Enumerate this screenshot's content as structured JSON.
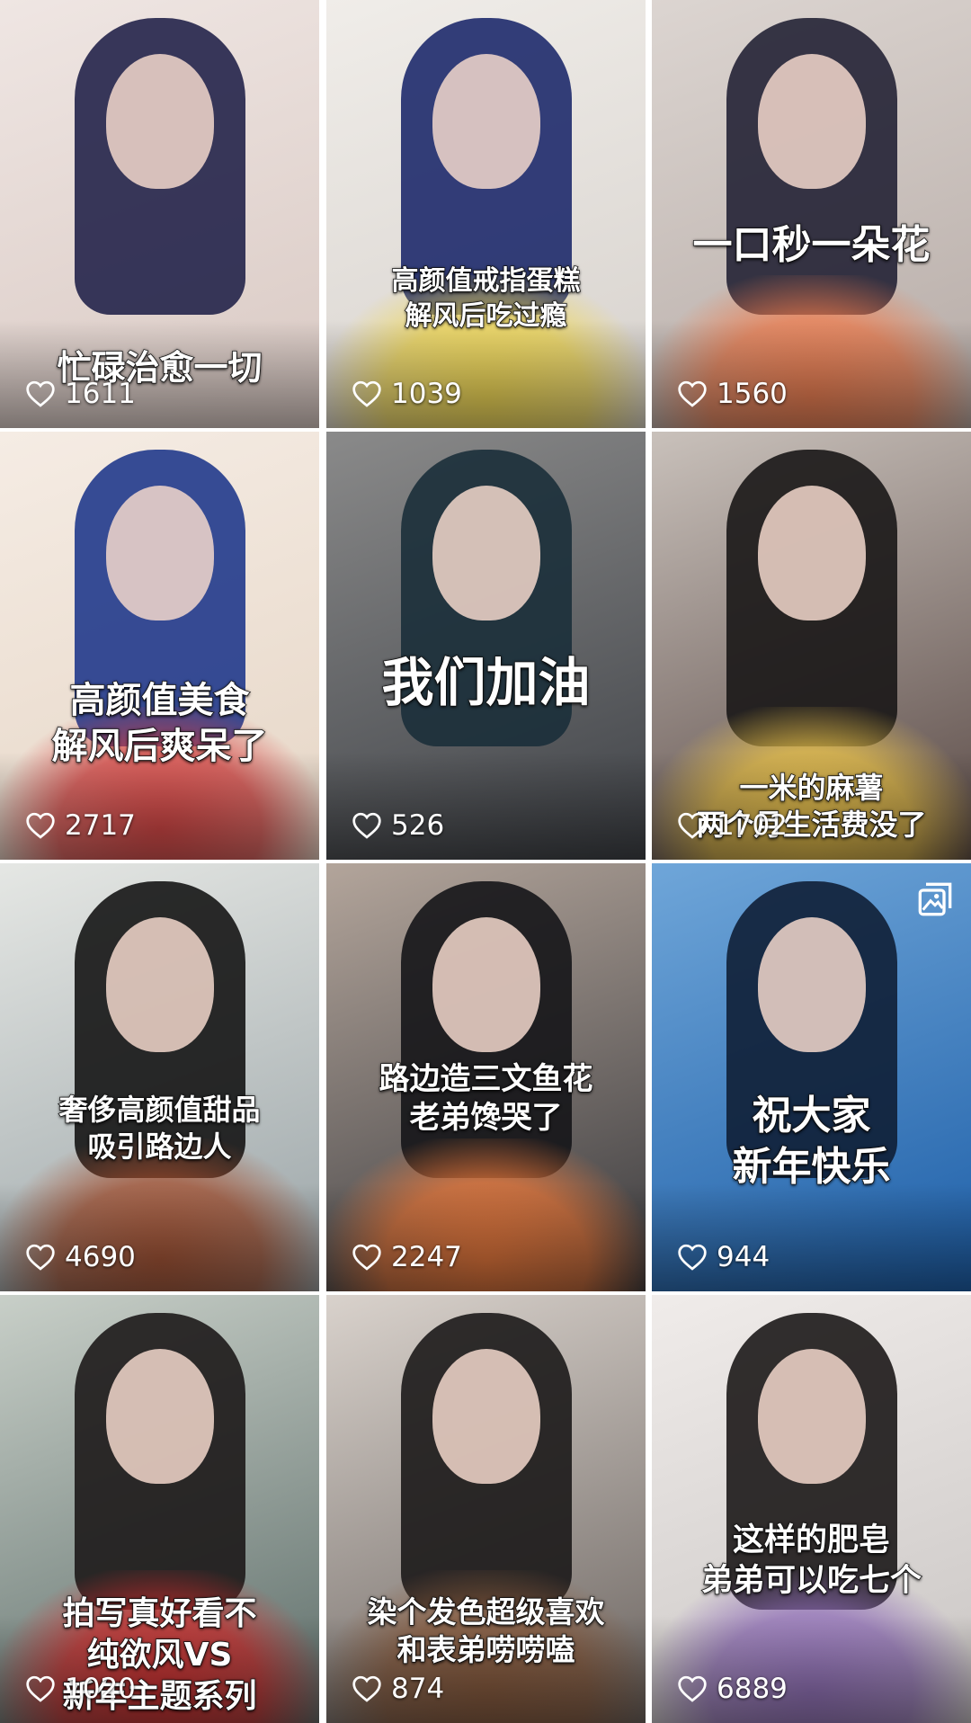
{
  "feed": {
    "items": [
      {
        "caption": [
          "忙碌治愈一切"
        ],
        "likes": "1611",
        "bg": [
          "#d9c9c3",
          "#efe6e3"
        ],
        "hair": "#23244a",
        "food": "",
        "icon": "heart-icon"
      },
      {
        "caption": [
          "高颜值戒指蛋糕",
          "解风后吃过瘾"
        ],
        "likes": "1039",
        "bg": [
          "#d7d2cd",
          "#f0ede9"
        ],
        "hair": "#1e2a6b",
        "food": "#f2d84a",
        "icon": "heart-icon"
      },
      {
        "caption": [
          "一口秒一朵花"
        ],
        "likes": "1560",
        "bg": [
          "#b6aba6",
          "#dcd5d1"
        ],
        "hair": "#232235",
        "food": "#f07a4a",
        "icon": "heart-icon"
      },
      {
        "caption": [
          "高颜值美食",
          "解风后爽呆了"
        ],
        "likes": "2717",
        "bg": [
          "#e6d6c6",
          "#f5ece4"
        ],
        "hair": "#213a8c",
        "food": "#d63a3a",
        "icon": "heart-icon"
      },
      {
        "caption": [
          "我们加油"
        ],
        "likes": "526",
        "bg": [
          "#3f4247",
          "#8a8a8a"
        ],
        "hair": "#1b2f3a",
        "food": "",
        "icon": "heart-icon"
      },
      {
        "caption": [
          "一米的麻薯",
          "两个月生活费没了"
        ],
        "likes": "1702",
        "bg": [
          "#5a4a46",
          "#c9c1bb"
        ],
        "hair": "#1a1717",
        "food": "#f1c84a",
        "icon": "heart-icon"
      },
      {
        "caption": [
          "奢侈高颜值甜品",
          "吸引路边人"
        ],
        "likes": "4690",
        "bg": [
          "#9aa4a7",
          "#e5e7e4"
        ],
        "hair": "#151515",
        "food": "#a24b2a",
        "icon": "heart-icon"
      },
      {
        "caption": [
          "路边造三文鱼花",
          "老弟馋哭了"
        ],
        "likes": "2247",
        "bg": [
          "#3a3a3d",
          "#b3a59b"
        ],
        "hair": "#151518",
        "food": "#f07a3a",
        "icon": "heart-icon"
      },
      {
        "caption": [
          "祝大家",
          "新年快乐"
        ],
        "likes": "944",
        "bg": [
          "#1e5fa8",
          "#6fa6d9"
        ],
        "hair": "#0f1f36",
        "food": "",
        "icon": "heart-icon",
        "album": "album-icon"
      },
      {
        "caption": [
          "拍写真好看不",
          "纯欲风VS",
          "新年主题系列"
        ],
        "likes": "1020",
        "bg": [
          "#5e6e6a",
          "#c8cfc8"
        ],
        "hair": "#1d1a1a",
        "food": "#d42b2b",
        "icon": "heart-icon"
      },
      {
        "caption": [
          "染个发色超级喜欢",
          "和表弟唠唠嗑"
        ],
        "likes": "874",
        "bg": [
          "#6b6460",
          "#d9d2cc"
        ],
        "hair": "#1c1a1a",
        "food": "#8a5a3b",
        "icon": "heart-icon"
      },
      {
        "caption": [
          "这样的肥皂",
          "弟弟可以吃七个"
        ],
        "likes": "6889",
        "bg": [
          "#c9c5c3",
          "#f0ecea"
        ],
        "hair": "#1c1818",
        "food": "#8d6ab7",
        "icon": "heart-icon"
      }
    ]
  },
  "colors": {
    "caption_text": "#ffffff",
    "caption_stroke": "#1a1a1a",
    "likes_text": "#ffffff"
  }
}
